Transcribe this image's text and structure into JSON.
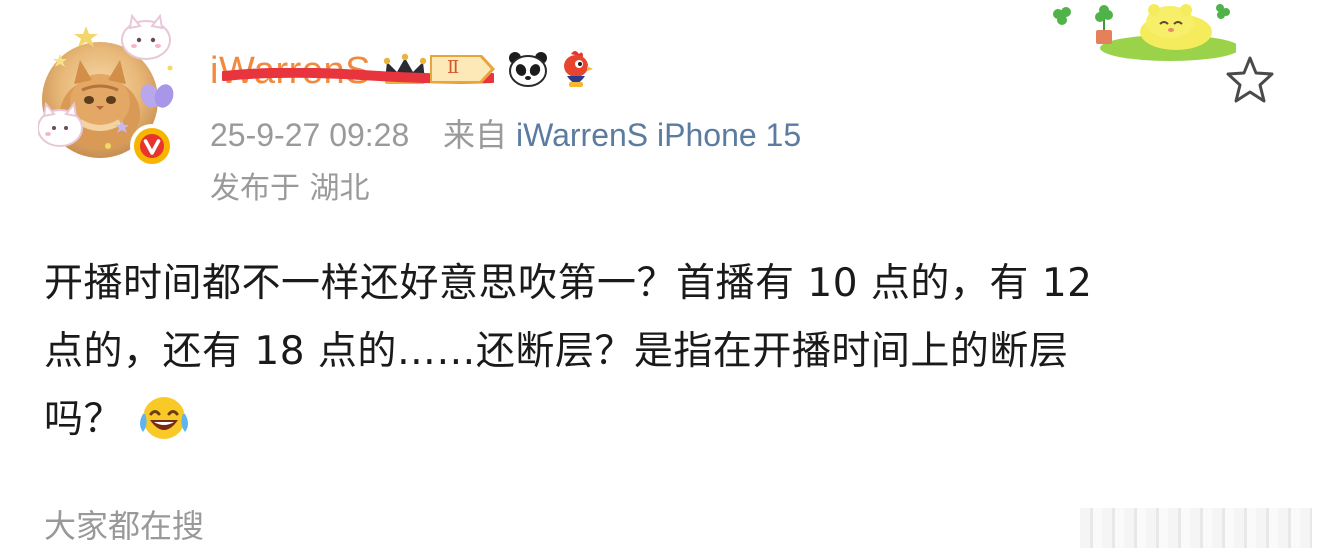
{
  "user": {
    "name": "iWarrenS",
    "badge_level": "Ⅱ"
  },
  "post": {
    "date": "25-9-27 09:28",
    "source_prefix": "来自",
    "source": "iWarrenS iPhone 15",
    "location": "发布于 湖北",
    "text_lines": [
      "开播时间都不一样还好意思吹第一？首播有 10 点的，有 12",
      "点的，还有 18 点的……还断层？是指在开播时间上的断层",
      "吗？"
    ]
  },
  "footer": {
    "search_label": "大家都在搜"
  },
  "colors": {
    "username": "#f08a3e",
    "meta": "#9a9a9a",
    "source_link": "#5b7ba0",
    "verified": "#f7b500",
    "body_text": "#1a1a1a"
  },
  "icons": [
    "verified-v-icon",
    "crown-icon",
    "level-badge-icon",
    "panda-icon",
    "chicken-icon",
    "star-outline-icon",
    "laughing-tears-emoji-icon"
  ]
}
